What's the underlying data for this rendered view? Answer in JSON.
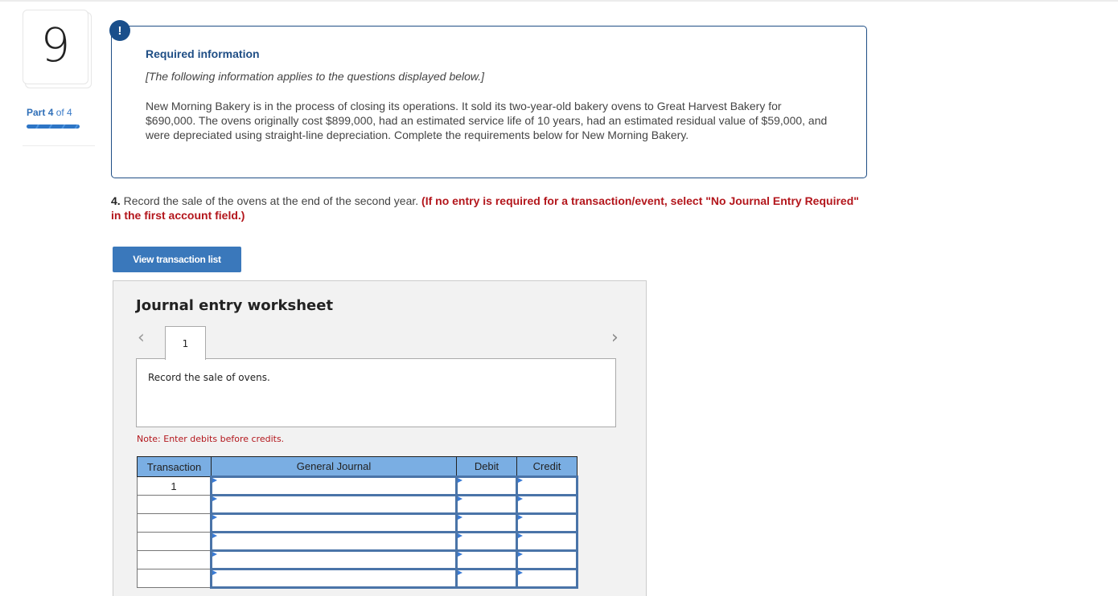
{
  "sidebar": {
    "question_number": "9",
    "part": {
      "prefix": "Part",
      "current": "4",
      "of_label": "of 4",
      "progress_fraction": 1.0
    }
  },
  "required_info": {
    "icon": "exclamation-icon",
    "icon_glyph": "!",
    "title": "Required information",
    "intro": "[The following information applies to the questions displayed below.]",
    "body": "New Morning Bakery is in the process of closing its operations. It sold its two-year-old bakery ovens to Great Harvest Bakery for $690,000. The ovens originally cost $899,000, had an estimated service life of 10 years, had an estimated residual value of $59,000, and were depreciated using straight-line depreciation. Complete the requirements below for New Morning Bakery."
  },
  "question": {
    "number": "4.",
    "text": " Record the sale of the ovens at the end of the second year. ",
    "instruction": "(If no entry is required for a transaction/event, select \"No Journal Entry Required\" in the first account field.)"
  },
  "buttons": {
    "view_transaction_list": "View transaction list"
  },
  "worksheet": {
    "title": "Journal entry worksheet",
    "prev_icon": "chevron-left-icon",
    "next_icon": "chevron-right-icon",
    "prev_glyph": "‹",
    "next_glyph": "›",
    "tabs": [
      {
        "label": "1"
      }
    ],
    "description": "Record the sale of ovens.",
    "note": "Note: Enter debits before credits.",
    "table": {
      "columns": [
        "Transaction",
        "General Journal",
        "Debit",
        "Credit"
      ],
      "rows": [
        {
          "transaction": "1",
          "account": "",
          "debit": "",
          "credit": ""
        },
        {
          "transaction": "",
          "account": "",
          "debit": "",
          "credit": ""
        },
        {
          "transaction": "",
          "account": "",
          "debit": "",
          "credit": ""
        },
        {
          "transaction": "",
          "account": "",
          "debit": "",
          "credit": ""
        },
        {
          "transaction": "",
          "account": "",
          "debit": "",
          "credit": ""
        },
        {
          "transaction": "",
          "account": "",
          "debit": "",
          "credit": ""
        }
      ]
    }
  },
  "colors": {
    "brand_navy": "#1f4e85",
    "button_blue": "#3a78bb",
    "header_blue": "#7aaee3",
    "alert_red": "#b3161c"
  }
}
